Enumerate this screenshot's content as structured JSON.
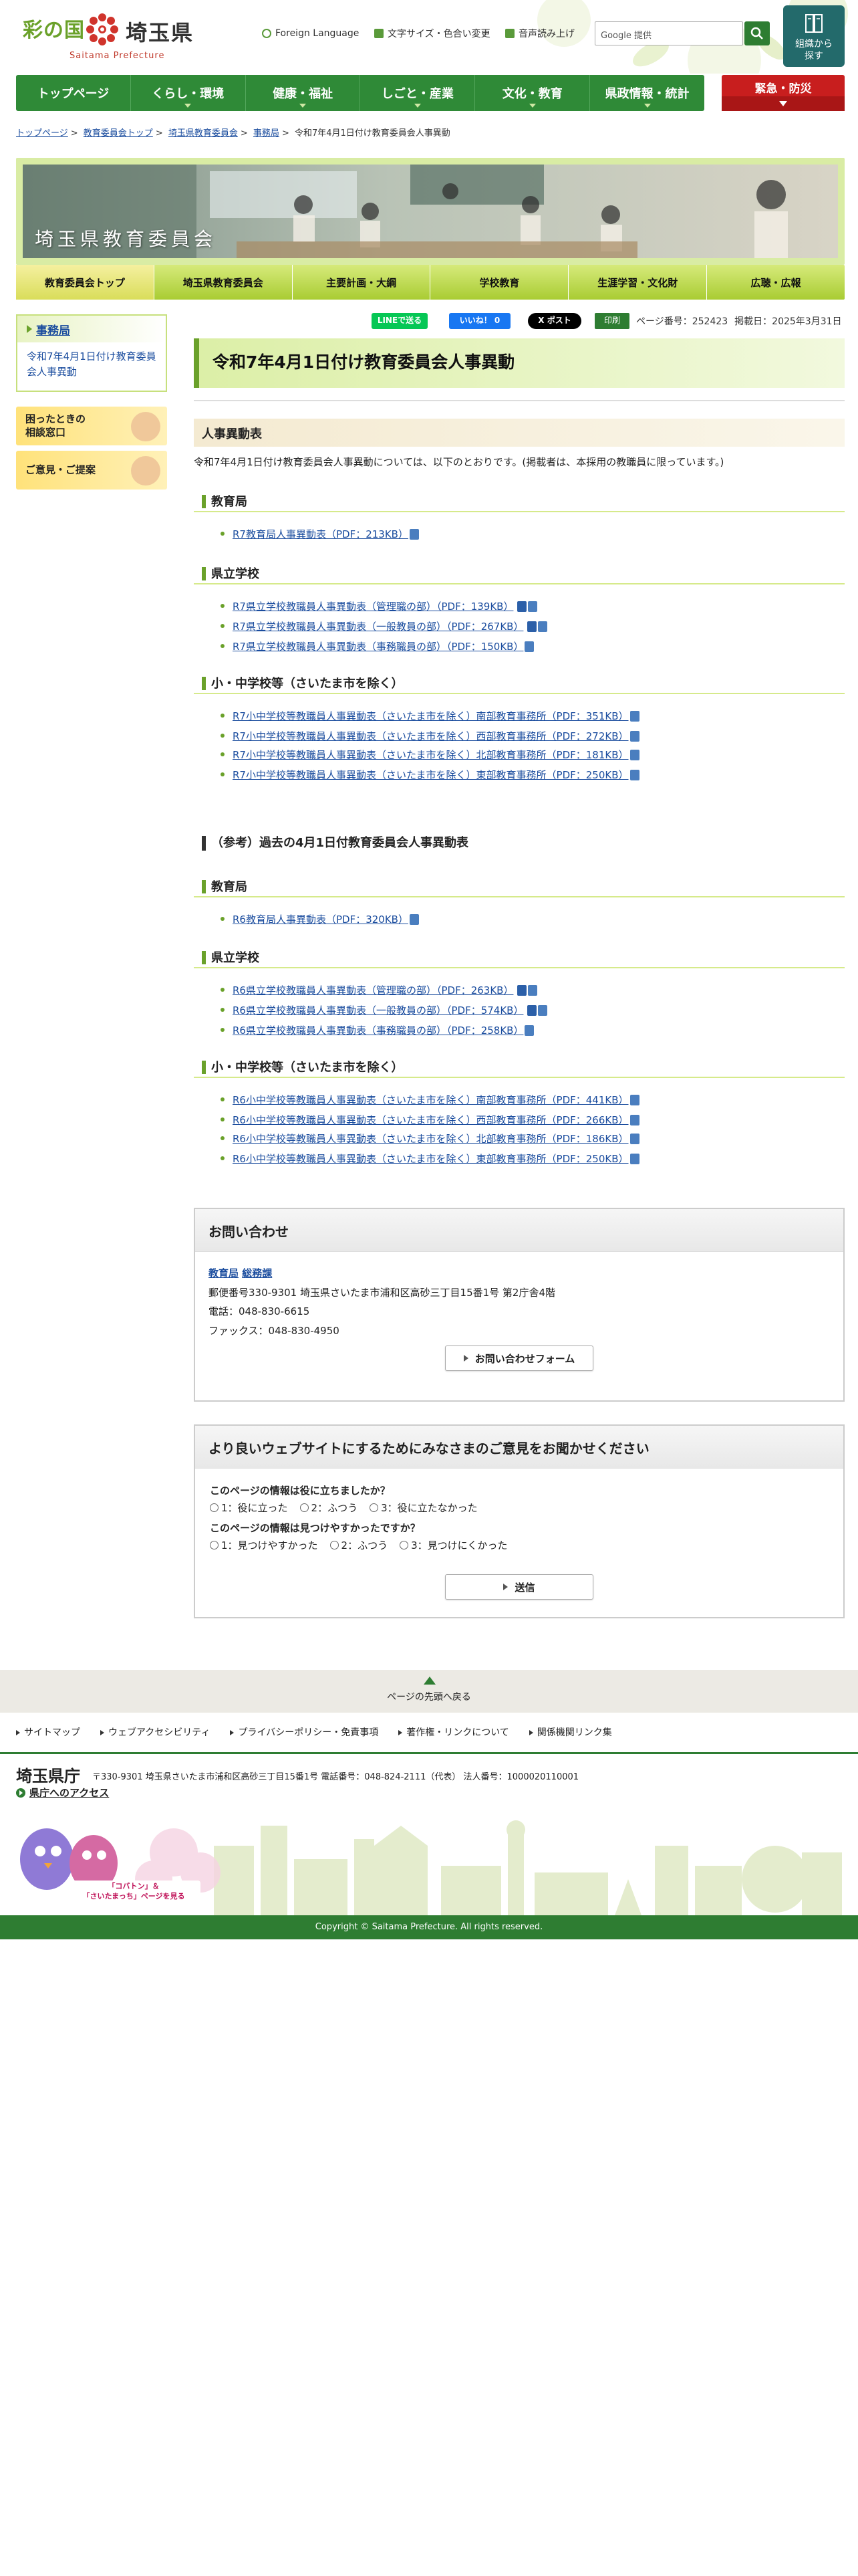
{
  "header": {
    "logo_jp": "彩の国",
    "logo_pref": "埼玉県",
    "logo_en": "Saitama Prefecture",
    "util": {
      "foreign": "Foreign Language",
      "fontsize": "文字サイズ・色合い変更",
      "speech": "音声読み上げ"
    },
    "search_placeholder": "Google 提供",
    "org_button": "組織から\n探す"
  },
  "gnav": [
    "トップページ",
    "くらし・環境",
    "健康・福祉",
    "しごと・産業",
    "文化・教育",
    "県政情報・統計"
  ],
  "emergency": "緊急・防災",
  "breadcrumb": {
    "items": [
      "トップページ",
      "教育委員会トップ",
      "埼玉県教育委員会",
      "事務局"
    ],
    "sep": ">",
    "current": "令和7年4月1日付け教育委員会人事異動"
  },
  "banner": {
    "title": "埼玉県教育委員会"
  },
  "subnav": [
    "教育委員会トップ",
    "埼玉県教育委員会",
    "主要計画・大綱",
    "学校教育",
    "生涯学習・文化財",
    "広聴・広報"
  ],
  "sidebar": {
    "heading": "事務局",
    "link": "令和7年4月1日付け教育委員会人事異動",
    "banner1": "困ったときの\n相談窓口",
    "banner2": "ご意見・ご提案"
  },
  "share": {
    "line": "LINEで送る",
    "facebook": "いいね！ 0",
    "x": "X ポスト",
    "print": "印刷"
  },
  "page_info": {
    "number": "ページ番号：252423",
    "date": "掲載日：2025年3月31日"
  },
  "main": {
    "title": "令和7年4月1日付け教育委員会人事異動",
    "section": "人事異動表",
    "intro": "令和7年4月1日付け教育委員会人事異動については、以下のとおりです。(掲載者は、本採用の教職員に限っています。)",
    "h_kyouikukyoku": "教育局",
    "link_kyouikukyoku": "R7教育局人事異動表（PDF：213KB）",
    "h_kenritsu": "県立学校",
    "links_kenritsu": [
      "R7県立学校教職員人事異動表（管理職の部）（PDF：139KB）",
      "R7県立学校教職員人事異動表（一般教員の部）（PDF：267KB）",
      "R7県立学校教職員人事異動表（事務職員の部）（PDF：150KB）"
    ],
    "h_shochu": "小・中学校等（さいたま市を除く）",
    "links_shochu": [
      "R7小中学校等教職員人事異動表（さいたま市を除く）南部教育事務所（PDF：351KB）",
      "R7小中学校等教職員人事異動表（さいたま市を除く）西部教育事務所（PDF：272KB）",
      "R7小中学校等教職員人事異動表（さいたま市を除く）北部教育事務所（PDF：181KB）",
      "R7小中学校等教職員人事異動表（さいたま市を除く）東部教育事務所（PDF：250KB）"
    ],
    "h_past": "（参考）過去の4月1日付教育委員会人事異動表",
    "h_kyouikukyoku_past": "教育局",
    "link_kyouikukyoku_past": "R6教育局人事異動表（PDF：320KB）",
    "h_kenritsu_past": "県立学校",
    "links_kenritsu_past": [
      "R6県立学校教職員人事異動表（管理職の部）（PDF：263KB）",
      "R6県立学校教職員人事異動表（一般教員の部）（PDF：574KB）",
      "R6県立学校教職員人事異動表（事務職員の部）（PDF：258KB）"
    ],
    "h_shochu_past": "小・中学校等（さいたま市を除く）",
    "links_shochu_past": [
      "R6小中学校等教職員人事異動表（さいたま市を除く）南部教育事務所（PDF：441KB）",
      "R6小中学校等教職員人事異動表（さいたま市を除く）西部教育事務所（PDF：266KB）",
      "R6小中学校等教職員人事異動表（さいたま市を除く）北部教育事務所（PDF：186KB）",
      "R6小中学校等教職員人事異動表（さいたま市を除く）東部教育事務所（PDF：250KB）"
    ]
  },
  "contact": {
    "heading": "お問い合わせ",
    "dept1": "教育局",
    "dept2": "総務課",
    "address": "郵便番号330-9301 埼玉県さいたま市浦和区高砂三丁目15番1号 第2庁舎4階",
    "tel": "電話：048-830-6615",
    "fax": "ファックス：048-830-4950",
    "form_button": "お問い合わせフォーム"
  },
  "feedback": {
    "heading": "より良いウェブサイトにするためにみなさまのご意見をお聞かせください",
    "q1": "このページの情報は役に立ちましたか？",
    "q1_opts": [
      "1：役に立った",
      "2：ふつう",
      "3：役に立たなかった"
    ],
    "q2": "このページの情報は見つけやすかったですか？",
    "q2_opts": [
      "1：見つけやすかった",
      "2：ふつう",
      "3：見つけにくかった"
    ],
    "submit": "送信"
  },
  "footer": {
    "back_top": "ページの先頭へ戻る",
    "links": [
      "サイトマップ",
      "ウェブアクセシビリティ",
      "プライバシーポリシー・免責事項",
      "著作権・リンクについて",
      "関係機関リンク集"
    ],
    "name": "埼玉県庁",
    "address": "〒330-9301 埼玉県さいたま市浦和区高砂三丁目15番1号 電話番号：048-824-2111（代表） 法人番号：1000020110001",
    "access": "県庁へのアクセス",
    "mascot_caption": "「コバトン」＆\n「さいたまっち」ページを見る",
    "copyright": "Copyright © Saitama Prefecture. All rights reserved."
  },
  "colors": {
    "brand_green": "#2e7d32",
    "accent_lime": "#a9cc33",
    "emergency_red": "#c81e1e",
    "link_blue": "#1a4c9e"
  }
}
